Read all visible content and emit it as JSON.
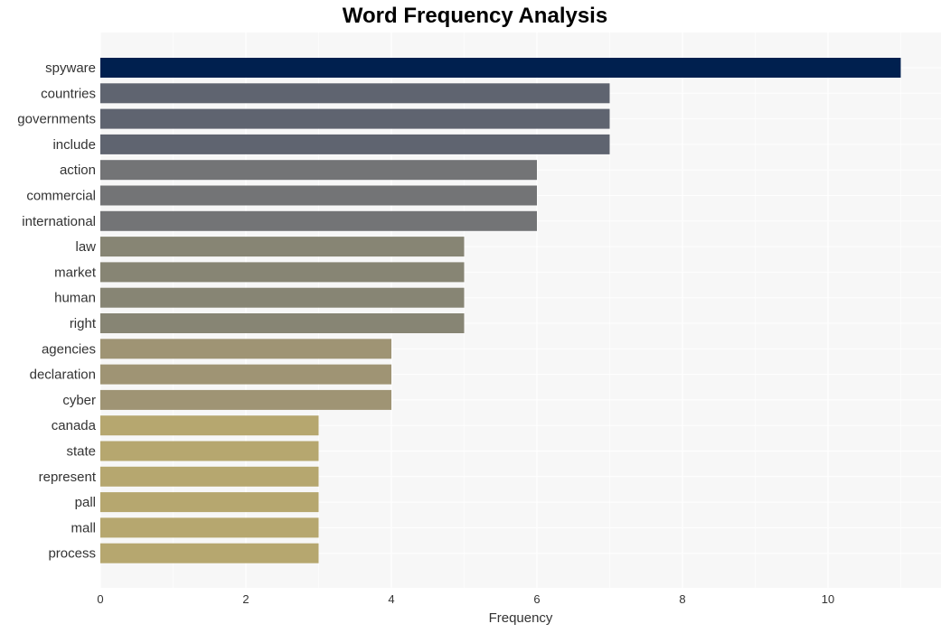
{
  "chart_data": {
    "type": "bar",
    "orientation": "horizontal",
    "title": "Word Frequency Analysis",
    "xlabel": "Frequency",
    "ylabel": "",
    "xlim": [
      0,
      11.5
    ],
    "xticks": [
      0,
      2,
      4,
      6,
      8,
      10
    ],
    "grid": true,
    "legend": "none",
    "categories": [
      "spyware",
      "countries",
      "governments",
      "include",
      "action",
      "commercial",
      "international",
      "law",
      "market",
      "human",
      "right",
      "agencies",
      "declaration",
      "cyber",
      "canada",
      "state",
      "represent",
      "pall",
      "mall",
      "process"
    ],
    "values": [
      11,
      7,
      7,
      7,
      6,
      6,
      6,
      5,
      5,
      5,
      5,
      4,
      4,
      4,
      3,
      3,
      3,
      3,
      3,
      3
    ],
    "colors": [
      "#00204f",
      "#5f6470",
      "#5f6470",
      "#5f6470",
      "#737476",
      "#737476",
      "#737476",
      "#878574",
      "#878574",
      "#878574",
      "#878574",
      "#9f9474",
      "#9f9474",
      "#9f9474",
      "#b6a76f",
      "#b6a76f",
      "#b6a76f",
      "#b6a76f",
      "#b6a76f",
      "#b6a76f"
    ]
  }
}
